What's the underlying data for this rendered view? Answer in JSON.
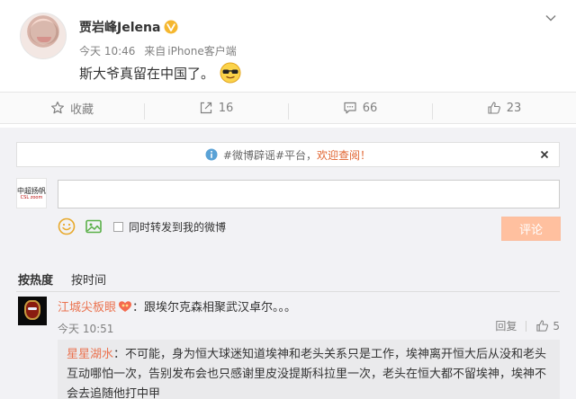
{
  "post": {
    "author": "贾岩峰Jelena",
    "time": "今天 10:46",
    "source_prefix": "来自",
    "source": "iPhone客户端",
    "content": "斯大爷真留在中国了。",
    "verified_color": "#f5b72f"
  },
  "actions": {
    "favorite_label": "收藏",
    "repost_count": "16",
    "comment_count": "66",
    "like_count": "23"
  },
  "tip_bar": {
    "prefix": "#微博辟谣#平台，",
    "link": "欢迎查阅！"
  },
  "composer": {
    "avatar_text": "中超扬帆",
    "avatar_sub": "CSL zoom",
    "input_value": "",
    "sync_label": "同时转发到我的微博",
    "submit_label": "评论"
  },
  "sort_tabs": [
    {
      "label": "按热度"
    },
    {
      "label": "按时间"
    }
  ],
  "comment": {
    "user": "江城尖板眼",
    "text": "：跟埃尔克森相聚武汉卓尔。。。",
    "time": "今天 10:51",
    "reply_label": "回复",
    "like_count": "5"
  },
  "sub_reply": {
    "user": "星星湖水",
    "text": "：不可能，身为恒大球迷知道埃神和老头关系只是工作，埃神离开恒大后从没和老头互动哪怕一次，告别发布会也只感谢里皮没提斯科拉里一次，老头在恒大都不留埃神，埃神不会去追随他打中甲"
  },
  "colors": {
    "accent": "#eb7350",
    "submit_disabled": "#ffc09f",
    "panel_bg": "#f2f2f5"
  }
}
